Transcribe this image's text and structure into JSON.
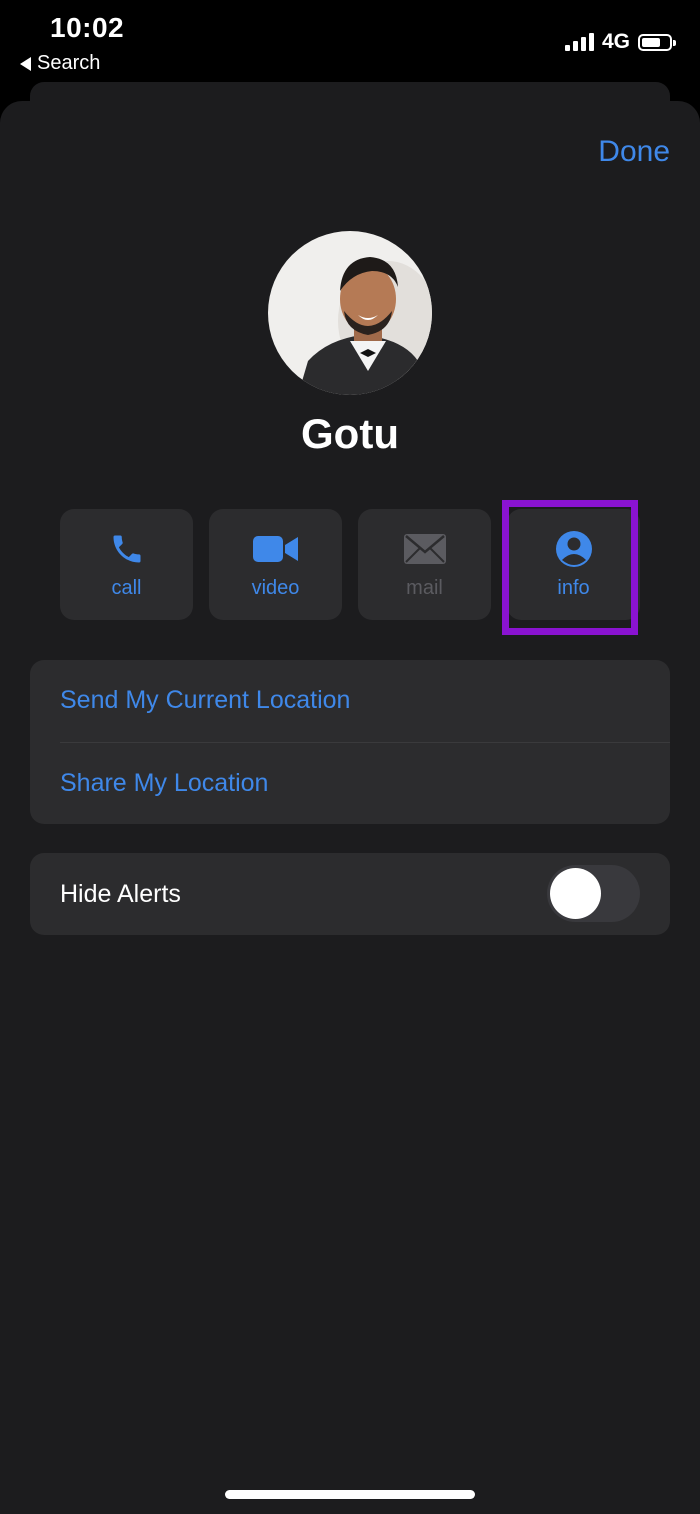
{
  "status_bar": {
    "time": "10:02",
    "back_label": "Search",
    "network": "4G"
  },
  "header": {
    "done_label": "Done"
  },
  "contact": {
    "name": "Gotu"
  },
  "actions": [
    {
      "label": "call",
      "icon": "phone-icon",
      "enabled": true
    },
    {
      "label": "video",
      "icon": "video-camera-icon",
      "enabled": true
    },
    {
      "label": "mail",
      "icon": "envelope-icon",
      "enabled": false
    },
    {
      "label": "info",
      "icon": "person-circle-icon",
      "enabled": true,
      "highlighted": true
    }
  ],
  "location_group": {
    "send_current": "Send My Current Location",
    "share": "Share My Location"
  },
  "alerts_group": {
    "hide_alerts_label": "Hide Alerts",
    "hide_alerts_on": false
  },
  "colors": {
    "accent": "#3f88e9",
    "highlight": "#8a13d1",
    "sheet_bg": "#1c1c1e",
    "cell_bg": "#2c2c2e"
  }
}
